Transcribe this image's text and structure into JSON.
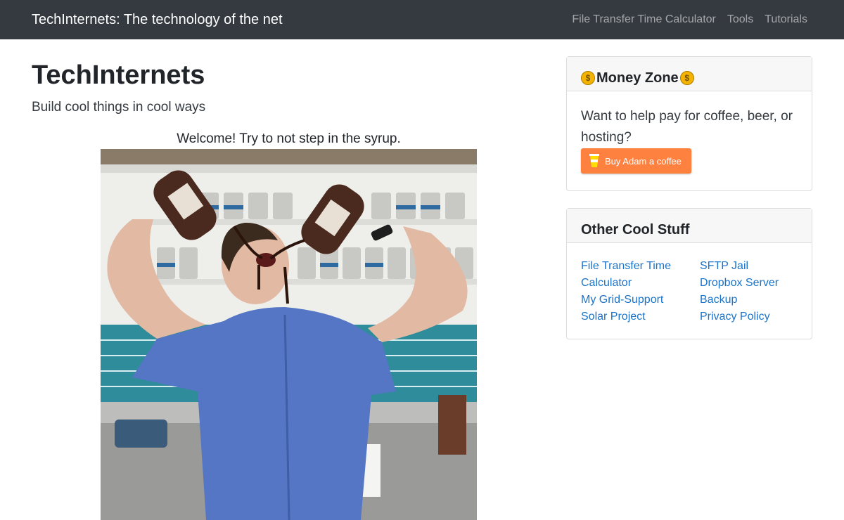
{
  "navbar": {
    "brand": "TechInternets: The technology of the net",
    "links": [
      "File Transfer Time Calculator",
      "Tools",
      "Tutorials"
    ]
  },
  "main": {
    "title": "TechInternets",
    "lead": "Build cool things in cool ways",
    "welcome": "Welcome! Try to not step in the syrup.",
    "photo_icon": "man-drinking-syrup-photo"
  },
  "money_zone": {
    "title": "Money Zone",
    "icon": "money-bag-icon",
    "text": "Want to help pay for coffee, beer, or hosting?",
    "button_label": "Buy Adam a coffee",
    "button_color": "#ff813f"
  },
  "other_stuff": {
    "title": "Other Cool Stuff",
    "left_links": [
      "File Transfer Time Calculator",
      "My Grid-Support",
      "Solar Project"
    ],
    "right_links": [
      "SFTP Jail",
      "Dropbox Server",
      "Backup",
      "Privacy Policy"
    ],
    "link_color": "#1a73c9"
  }
}
